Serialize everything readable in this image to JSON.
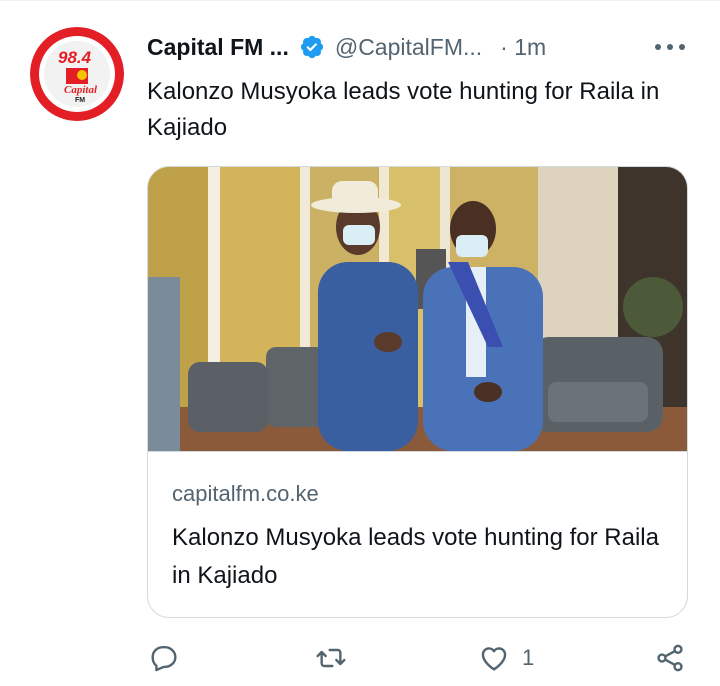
{
  "author": {
    "name": "Capital FM ...",
    "handle": "@CapitalFM...",
    "time": "· 1m",
    "verified": true,
    "avatar_logo_text": "98.4 Capital FM"
  },
  "tweet": {
    "text": "Kalonzo Musyoka leads vote hunting for Raila in Kajiado"
  },
  "card": {
    "domain": "capitalfm.co.ke",
    "title": "Kalonzo Musyoka leads vote hunting for Raila in Kajiado"
  },
  "actions": {
    "like_count": "1"
  },
  "colors": {
    "verified": "#1d9bf0",
    "secondary_text": "#536471",
    "border": "#cfd9de",
    "logo_red": "#e31e24"
  },
  "icons": [
    "verified-badge-icon",
    "more-icon",
    "reply-icon",
    "retweet-icon",
    "like-icon",
    "share-icon"
  ]
}
